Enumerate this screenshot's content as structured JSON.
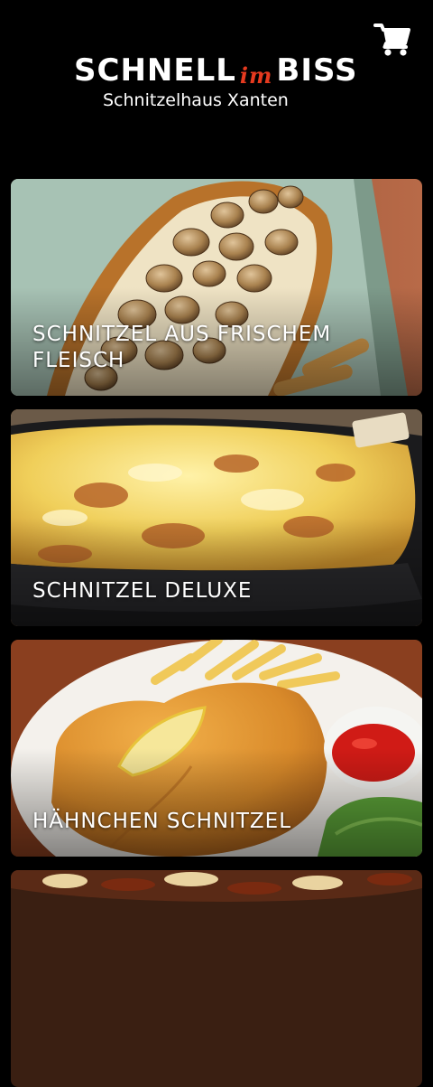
{
  "header": {
    "logo_line1_left": "SCHNELL",
    "logo_line1_mid": "im",
    "logo_line1_right": "BISS",
    "logo_line2": "Schnitzelhaus Xanten",
    "cart_icon": "shopping-cart-icon"
  },
  "categories": [
    {
      "label": "SCHNITZEL AUS FRISCHEM FLEISCH"
    },
    {
      "label": "SCHNITZEL DELUXE"
    },
    {
      "label": "HÄHNCHEN SCHNITZEL"
    },
    {
      "label": ""
    }
  ],
  "colors": {
    "background": "#000000",
    "logo_accent": "#e63a1f",
    "text": "#ffffff"
  }
}
